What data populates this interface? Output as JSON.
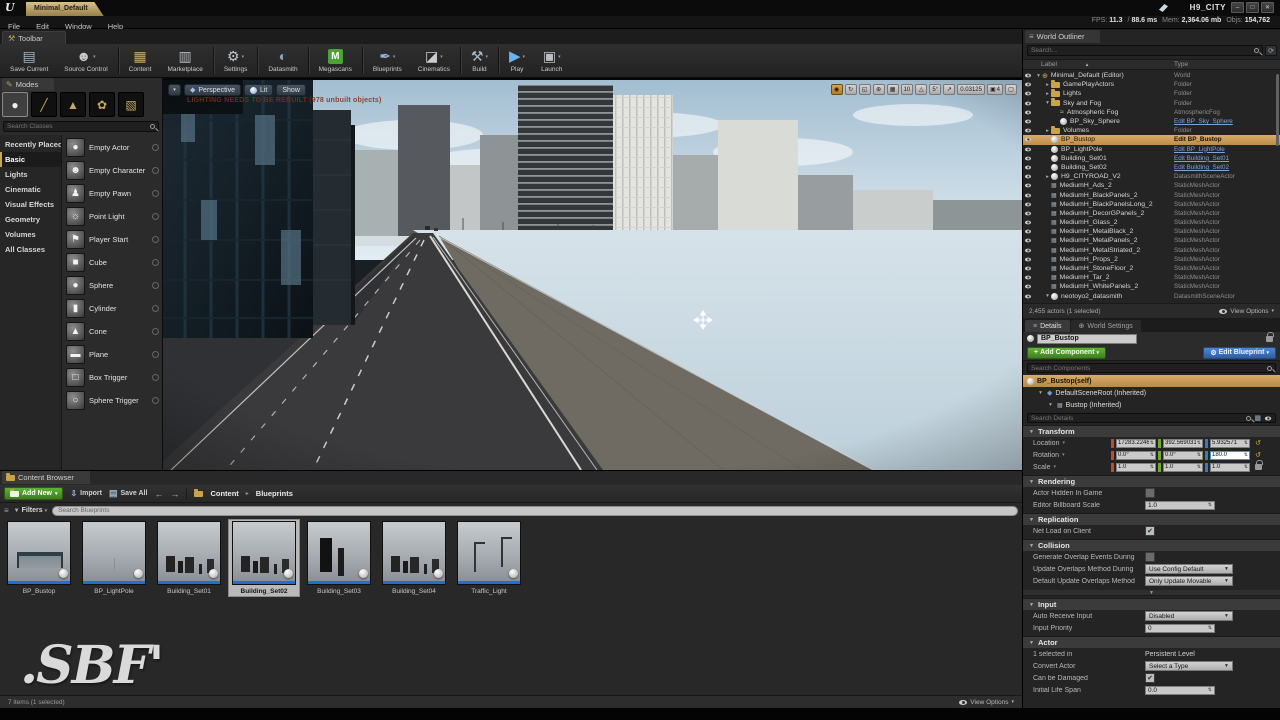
{
  "window": {
    "app_tab": "Minimal_Default",
    "title": "H9_CITY",
    "menus": [
      "File",
      "Edit",
      "Window",
      "Help"
    ],
    "stats": [
      {
        "label": "FPS:",
        "value": "11.3"
      },
      {
        "label": "/",
        "value": "88.6 ms"
      },
      {
        "label": "Mem:",
        "value": "2,364.06 mb"
      },
      {
        "label": "Objs:",
        "value": "154,762"
      }
    ],
    "controls": [
      {
        "name": "minimize",
        "glyph": "–"
      },
      {
        "name": "restore",
        "glyph": "□"
      },
      {
        "name": "close",
        "glyph": "✕"
      }
    ]
  },
  "toolbar": {
    "tab": "Toolbar",
    "buttons": [
      {
        "label": "Save Current",
        "icon": "save"
      },
      {
        "label": "Source Control",
        "icon": "source-control",
        "dropdown": true,
        "sep": true
      },
      {
        "label": "Content",
        "icon": "content"
      },
      {
        "label": "Marketplace",
        "icon": "marketplace",
        "sep": true
      },
      {
        "label": "Settings",
        "icon": "settings",
        "dropdown": true,
        "sep": true
      },
      {
        "label": "Datasmith",
        "icon": "datasmith",
        "sep": true
      },
      {
        "label": "Megascans",
        "icon": "megascans",
        "sep": true
      },
      {
        "label": "Blueprints",
        "icon": "blueprints",
        "dropdown": true
      },
      {
        "label": "Cinematics",
        "icon": "cinematics",
        "dropdown": true,
        "sep": true
      },
      {
        "label": "Build",
        "icon": "build",
        "dropdown": true,
        "sep": true
      },
      {
        "label": "Play",
        "icon": "play",
        "dropdown": true
      },
      {
        "label": "Launch",
        "icon": "launch",
        "dropdown": true
      }
    ]
  },
  "modes": {
    "tab": "Modes",
    "tools": [
      {
        "name": "place-mode",
        "active": true
      },
      {
        "name": "paint-mode"
      },
      {
        "name": "landscape-mode"
      },
      {
        "name": "foliage-mode"
      },
      {
        "name": "geometry-mode"
      }
    ],
    "search_placeholder": "Search Classes",
    "categories": [
      {
        "label": "Recently Placed"
      },
      {
        "label": "Basic",
        "active": true
      },
      {
        "label": "Lights"
      },
      {
        "label": "Cinematic"
      },
      {
        "label": "Visual Effects"
      },
      {
        "label": "Geometry"
      },
      {
        "label": "Volumes"
      },
      {
        "label": "All Classes"
      }
    ],
    "items": [
      {
        "label": "Empty Actor",
        "icon": "actor"
      },
      {
        "label": "Empty Character",
        "icon": "character"
      },
      {
        "label": "Empty Pawn",
        "icon": "pawn"
      },
      {
        "label": "Point Light",
        "icon": "light"
      },
      {
        "label": "Player Start",
        "icon": "start"
      },
      {
        "label": "Cube",
        "icon": "cube"
      },
      {
        "label": "Sphere",
        "icon": "sphere"
      },
      {
        "label": "Cylinder",
        "icon": "cylinder"
      },
      {
        "label": "Cone",
        "icon": "cone"
      },
      {
        "label": "Plane",
        "icon": "plane"
      },
      {
        "label": "Box Trigger",
        "icon": "box-trigger"
      },
      {
        "label": "Sphere Trigger",
        "icon": "sphere-trigger"
      }
    ]
  },
  "viewport": {
    "persp": "Perspective",
    "lit": "Lit",
    "show": "Show",
    "warning": "LIGHTING NEEDS TO BE REBUILT (978 unbuilt objects)",
    "snap": [
      {
        "name": "transform-gizmo",
        "active": true
      },
      {
        "name": "rotate-tool"
      },
      {
        "name": "scale-tool"
      },
      {
        "name": "world-space-toggle"
      },
      {
        "name": "grid-snap-toggle"
      },
      {
        "name": "grid-snap-size",
        "label": "10"
      },
      {
        "name": "rotation-snap-toggle"
      },
      {
        "name": "rotation-snap-size",
        "label": "5°"
      },
      {
        "name": "scale-snap-toggle"
      },
      {
        "name": "scale-snap-size",
        "label": "0.03125"
      },
      {
        "name": "camera-speed",
        "label": "4"
      },
      {
        "name": "maximize-viewport"
      }
    ]
  },
  "outliner": {
    "tab": "World Outliner",
    "search_placeholder": "Search...",
    "col_label": "Label",
    "col_type": "Type",
    "rows": [
      {
        "label": "Minimal_Default (Editor)",
        "type": "World",
        "icon": "world",
        "indent": 0,
        "exp": "open"
      },
      {
        "label": "GamePlayActors",
        "type": "Folder",
        "icon": "folder",
        "indent": 1,
        "exp": "closed"
      },
      {
        "label": "Lights",
        "type": "Folder",
        "icon": "folder",
        "indent": 1,
        "exp": "closed"
      },
      {
        "label": "Sky and Fog",
        "type": "Folder",
        "icon": "folder",
        "indent": 1,
        "exp": "open"
      },
      {
        "label": "Atmospheric Fog",
        "type": "AtmosphericFog",
        "icon": "fog",
        "indent": 2
      },
      {
        "label": "BP_Sky_Sphere",
        "type": "Edit BP_Sky_Sphere",
        "icon": "sphere",
        "indent": 2,
        "link": true
      },
      {
        "label": "Volumes",
        "type": "Folder",
        "icon": "folder",
        "indent": 1,
        "exp": "closed"
      },
      {
        "label": "BP_Bustop",
        "type": "Edit BP_Bustop",
        "icon": "sphere",
        "indent": 1,
        "selected": true,
        "link": true
      },
      {
        "label": "BP_LightPole",
        "type": "Edit BP_LightPole",
        "icon": "sphere",
        "indent": 1,
        "link": true
      },
      {
        "label": "Building_Set01",
        "type": "Edit Building_Set01",
        "icon": "sphere",
        "indent": 1,
        "link": true
      },
      {
        "label": "Building_Set02",
        "type": "Edit Building_Set02",
        "icon": "sphere",
        "indent": 1,
        "link": true
      },
      {
        "label": "H9_CITYROAD_V2",
        "type": "DatasmithSceneActor",
        "icon": "sphere",
        "indent": 1,
        "exp": "closed"
      },
      {
        "label": "MediumH_Ads_2",
        "type": "StaticMeshActor",
        "icon": "mesh",
        "indent": 1
      },
      {
        "label": "MediumH_BlackPanels_2",
        "type": "StaticMeshActor",
        "icon": "mesh",
        "indent": 1
      },
      {
        "label": "MediumH_BlackPanelsLong_2",
        "type": "StaticMeshActor",
        "icon": "mesh",
        "indent": 1
      },
      {
        "label": "MediumH_DecorGPanels_2",
        "type": "StaticMeshActor",
        "icon": "mesh",
        "indent": 1
      },
      {
        "label": "MediumH_Glass_2",
        "type": "StaticMeshActor",
        "icon": "mesh",
        "indent": 1
      },
      {
        "label": "MediumH_MetalBlack_2",
        "type": "StaticMeshActor",
        "icon": "mesh",
        "indent": 1
      },
      {
        "label": "MediumH_MetalPanels_2",
        "type": "StaticMeshActor",
        "icon": "mesh",
        "indent": 1
      },
      {
        "label": "MediumH_MetalStriated_2",
        "type": "StaticMeshActor",
        "icon": "mesh",
        "indent": 1
      },
      {
        "label": "MediumH_Props_2",
        "type": "StaticMeshActor",
        "icon": "mesh",
        "indent": 1
      },
      {
        "label": "MediumH_StoneFloor_2",
        "type": "StaticMeshActor",
        "icon": "mesh",
        "indent": 1
      },
      {
        "label": "MediumH_Tar_2",
        "type": "StaticMeshActor",
        "icon": "mesh",
        "indent": 1
      },
      {
        "label": "MediumH_WhitePanels_2",
        "type": "StaticMeshActor",
        "icon": "mesh",
        "indent": 1
      },
      {
        "label": "neotoyo2_datasmith",
        "type": "DatasmithSceneActor",
        "icon": "sphere",
        "indent": 1,
        "exp": "open"
      }
    ],
    "footer": "2,455 actors (1 selected)",
    "view_options": "View Options"
  },
  "details": {
    "tab_details": "Details",
    "tab_world_settings": "World Settings",
    "name_value": "BP_Bustop",
    "add_component_label": "Add Component",
    "edit_blueprint_label": "Edit Blueprint",
    "search_components_placeholder": "Search Components",
    "components": [
      {
        "label": "BP_Bustop(self)"
      },
      {
        "label": "DefaultSceneRoot (Inherited)"
      },
      {
        "label": "Bustop (Inherited)"
      }
    ],
    "search_details_placeholder": "Search Details",
    "transform": {
      "header": "Transform",
      "location_label": "Location",
      "rotation_label": "Rotation",
      "scale_label": "Scale",
      "location": {
        "x": "17283.2246",
        "y": "392.569031",
        "z": "5.932571"
      },
      "rotation": {
        "x": "0.0°",
        "y": "0.0°",
        "z": "180.0"
      },
      "scale": {
        "x": "1.0",
        "y": "1.0",
        "z": "1.0"
      }
    },
    "rendering": {
      "header": "Rendering",
      "actor_hidden_label": "Actor Hidden In Game",
      "actor_hidden_checked": false,
      "billboard_label": "Editor Billboard Scale",
      "billboard_value": "1.0"
    },
    "replication": {
      "header": "Replication",
      "net_load_label": "Net Load on Client",
      "net_load_checked": true
    },
    "collision": {
      "header": "Collision",
      "generate_overlap_label": "Generate Overlap Events During",
      "generate_overlap_checked": false,
      "update_overlaps_label": "Update Overlaps Method During",
      "update_overlaps_value": "Use Config Default",
      "default_update_label": "Default Update Overlaps Method",
      "default_update_value": "Only Update Movable"
    },
    "input": {
      "header": "Input",
      "auto_receive_label": "Auto Receive Input",
      "auto_receive_value": "Disabled",
      "input_priority_label": "Input Priority",
      "input_priority_value": "0"
    },
    "actor": {
      "header": "Actor",
      "selected_in_label": "1 selected in",
      "selected_in_value": "Persistent Level",
      "convert_label": "Convert Actor",
      "convert_value": "Select a Type",
      "damaged_label": "Can be Damaged",
      "damaged_checked": true,
      "life_span_label": "Initial Life Span",
      "life_span_value": "0.0"
    }
  },
  "content_browser": {
    "tab": "Content Browser",
    "add_new": "Add New",
    "import": "Import",
    "save_all": "Save All",
    "path": [
      "Content",
      "Blueprints"
    ],
    "filters_label": "Filters",
    "search_placeholder": "Search Blueprints",
    "items": [
      {
        "name": "BP_Bustop",
        "art": "bustop"
      },
      {
        "name": "BP_LightPole",
        "art": "empty"
      },
      {
        "name": "Building_Set01",
        "art": "blocks"
      },
      {
        "name": "Building_Set02",
        "art": "blocks",
        "selected": true
      },
      {
        "name": "Building_Set03",
        "art": "towers"
      },
      {
        "name": "Building_Set04",
        "art": "blocks"
      },
      {
        "name": "Traffic_Light",
        "art": "poles"
      }
    ],
    "footer": "7 items (1 selected)",
    "view_options": "View Options"
  },
  "watermark": ".SBF'"
}
